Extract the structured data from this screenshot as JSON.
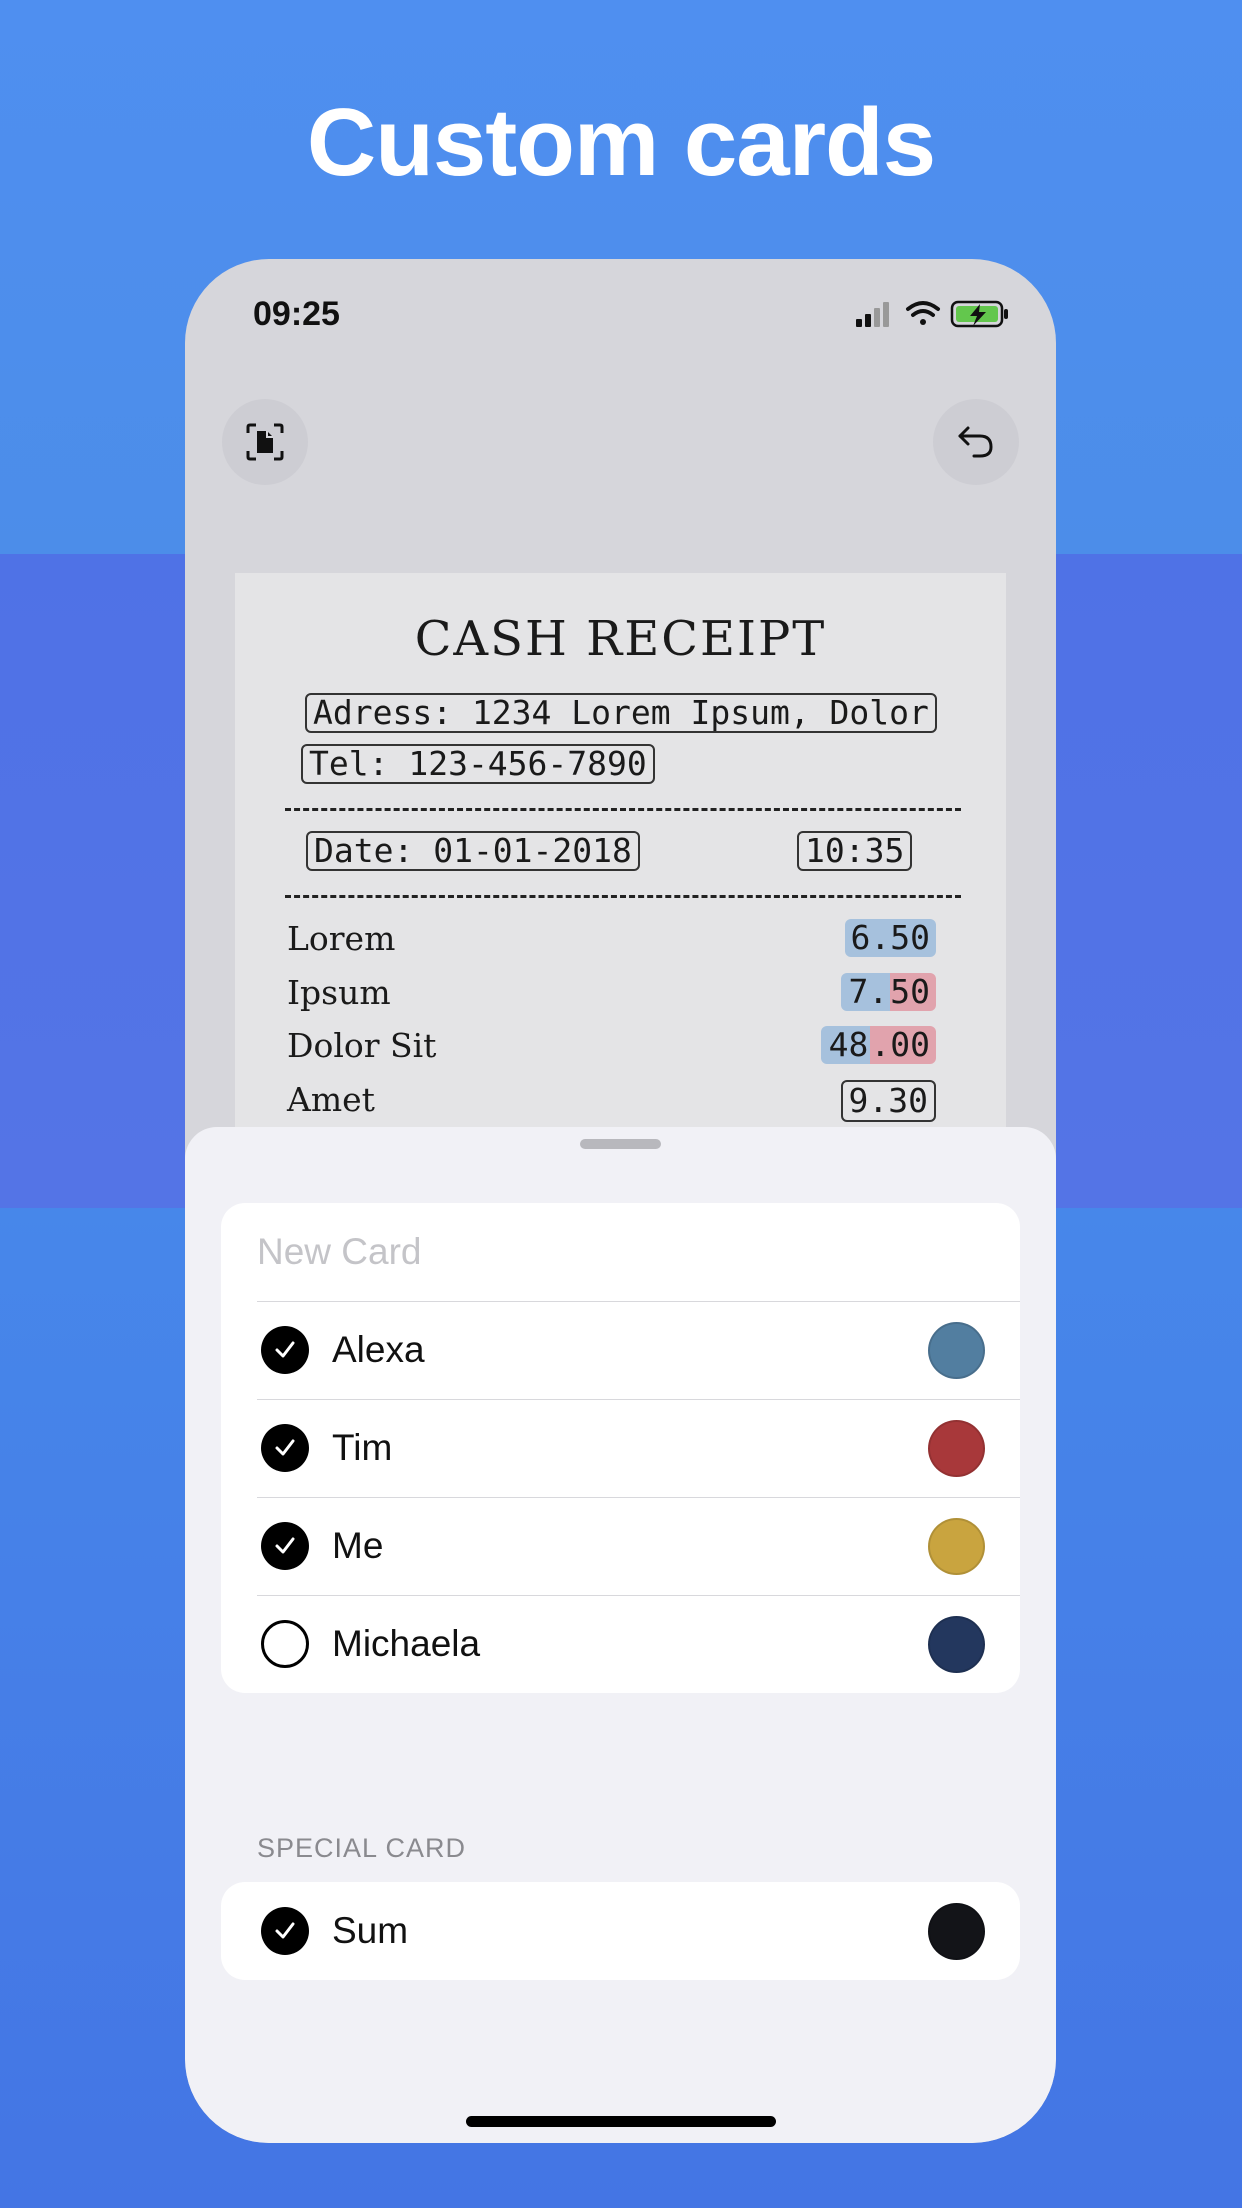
{
  "headline": "Custom cards",
  "status_bar": {
    "time": "09:25"
  },
  "toolbar": {
    "left_icon": "document-scan-icon",
    "right_icon": "undo-icon"
  },
  "receipt": {
    "title": "CASH RECEIPT",
    "address": "Adress: 1234 Lorem Ipsum, Dolor",
    "tel": "Tel: 123-456-7890",
    "date": "Date: 01-01-2018",
    "time": "10:35",
    "items": [
      {
        "name": "Lorem",
        "price_a": "6.50",
        "price_b": ""
      },
      {
        "name": "Ipsum",
        "price_a": "7.",
        "price_b": "50"
      },
      {
        "name": "Dolor Sit",
        "price_a": "48",
        "price_b": ".00"
      },
      {
        "name": "Amet",
        "price_a": "9.30",
        "price_b": ""
      }
    ]
  },
  "cards": {
    "new_card_placeholder": "New Card",
    "items": [
      {
        "label": "Alexa",
        "checked": true,
        "color": "#527ea0"
      },
      {
        "label": "Tim",
        "checked": true,
        "color": "#a8383a"
      },
      {
        "label": "Me",
        "checked": true,
        "color": "#c9a43f"
      },
      {
        "label": "Michaela",
        "checked": false,
        "color": "#23375e"
      }
    ]
  },
  "special": {
    "header": "SPECIAL CARD",
    "item": {
      "label": "Sum",
      "checked": true,
      "color": "#131418"
    }
  },
  "colors": {
    "highlight_blue": "#a6c1dd",
    "highlight_red": "#e1a3ad"
  }
}
